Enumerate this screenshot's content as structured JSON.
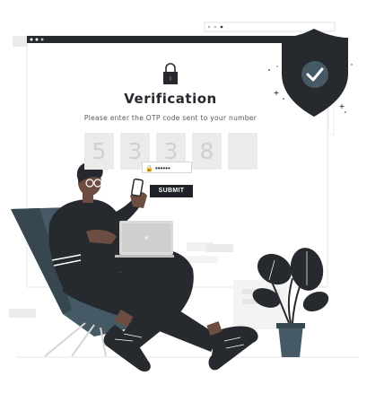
{
  "page": {
    "title": "Verification",
    "subtitle": "Please enter the OTP code sent to your number",
    "otp_digits": [
      "5",
      "3",
      "3",
      "8",
      ""
    ],
    "submit_label": "SUBMIT",
    "password_dots": "••••••"
  },
  "colors": {
    "dark": "#26292d",
    "otp_bg": "#ebebeb",
    "otp_text": "#d0d0d0",
    "shield": "#26292d",
    "check_circle": "#455a64"
  },
  "icons": [
    "lock-icon",
    "shield-check-icon",
    "plant",
    "laptop"
  ]
}
